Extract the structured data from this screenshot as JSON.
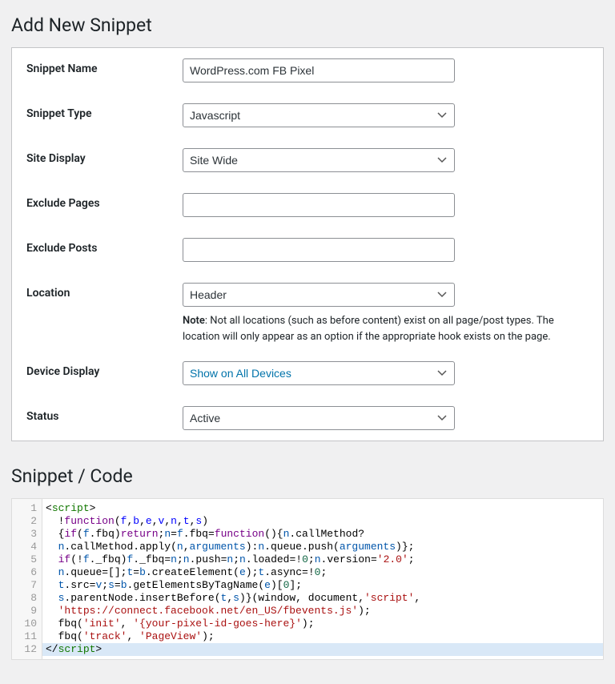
{
  "page": {
    "title": "Add New Snippet",
    "code_section_title": "Snippet / Code"
  },
  "labels": {
    "name": "Snippet Name",
    "type": "Snippet Type",
    "site_display": "Site Display",
    "exclude_pages": "Exclude Pages",
    "exclude_posts": "Exclude Posts",
    "location": "Location",
    "device_display": "Device Display",
    "status": "Status"
  },
  "values": {
    "name": "WordPress.com FB Pixel",
    "type": "Javascript",
    "site_display": "Site Wide",
    "exclude_pages": "",
    "exclude_posts": "",
    "location": "Header",
    "device_display": "Show on All Devices",
    "status": "Active"
  },
  "note": {
    "label": "Note",
    "text": ": Not all locations (such as before content) exist on all page/post types. The location will only appear as an option if the appropriate hook exists on the page."
  },
  "code": [
    {
      "n": 1,
      "html": "<span class='cm-punc'>&lt;</span><span class='cm-tag'>script</span><span class='cm-punc'>&gt;</span>"
    },
    {
      "n": 2,
      "html": "  <span class='cm-punc'>!</span><span class='cm-keyword'>function</span><span class='cm-punc'>(</span><span class='cm-def'>f</span><span class='cm-punc'>,</span><span class='cm-def'>b</span><span class='cm-punc'>,</span><span class='cm-def'>e</span><span class='cm-punc'>,</span><span class='cm-def'>v</span><span class='cm-punc'>,</span><span class='cm-def'>n</span><span class='cm-punc'>,</span><span class='cm-def'>t</span><span class='cm-punc'>,</span><span class='cm-def'>s</span><span class='cm-punc'>)</span>"
    },
    {
      "n": 3,
      "html": "  <span class='cm-punc'>{</span><span class='cm-keyword'>if</span><span class='cm-punc'>(</span><span class='cm-var2'>f</span><span class='cm-punc'>.</span><span class='cm-prop'>fbq</span><span class='cm-punc'>)</span><span class='cm-keyword'>return</span><span class='cm-punc'>;</span><span class='cm-var2'>n</span><span class='cm-punc'>=</span><span class='cm-var2'>f</span><span class='cm-punc'>.</span><span class='cm-prop'>fbq</span><span class='cm-punc'>=</span><span class='cm-keyword'>function</span><span class='cm-punc'>(){</span><span class='cm-var2'>n</span><span class='cm-punc'>.</span><span class='cm-prop'>callMethod</span><span class='cm-punc'>?</span>"
    },
    {
      "n": 4,
      "html": "  <span class='cm-var2'>n</span><span class='cm-punc'>.</span><span class='cm-prop'>callMethod</span><span class='cm-punc'>.</span><span class='cm-prop'>apply</span><span class='cm-punc'>(</span><span class='cm-var2'>n</span><span class='cm-punc'>,</span><span class='cm-var2'>arguments</span><span class='cm-punc'>):</span><span class='cm-var2'>n</span><span class='cm-punc'>.</span><span class='cm-prop'>queue</span><span class='cm-punc'>.</span><span class='cm-prop'>push</span><span class='cm-punc'>(</span><span class='cm-var2'>arguments</span><span class='cm-punc'>)};</span>"
    },
    {
      "n": 5,
      "html": "  <span class='cm-keyword'>if</span><span class='cm-punc'>(!</span><span class='cm-var2'>f</span><span class='cm-punc'>.</span><span class='cm-prop'>_fbq</span><span class='cm-punc'>)</span><span class='cm-var2'>f</span><span class='cm-punc'>.</span><span class='cm-prop'>_fbq</span><span class='cm-punc'>=</span><span class='cm-var2'>n</span><span class='cm-punc'>;</span><span class='cm-var2'>n</span><span class='cm-punc'>.</span><span class='cm-prop'>push</span><span class='cm-punc'>=</span><span class='cm-var2'>n</span><span class='cm-punc'>;</span><span class='cm-var2'>n</span><span class='cm-punc'>.</span><span class='cm-prop'>loaded</span><span class='cm-punc'>=!</span><span class='cm-num'>0</span><span class='cm-punc'>;</span><span class='cm-var2'>n</span><span class='cm-punc'>.</span><span class='cm-prop'>version</span><span class='cm-punc'>=</span><span class='cm-str'>'2.0'</span><span class='cm-punc'>;</span>"
    },
    {
      "n": 6,
      "html": "  <span class='cm-var2'>n</span><span class='cm-punc'>.</span><span class='cm-prop'>queue</span><span class='cm-punc'>=[];</span><span class='cm-var2'>t</span><span class='cm-punc'>=</span><span class='cm-var2'>b</span><span class='cm-punc'>.</span><span class='cm-prop'>createElement</span><span class='cm-punc'>(</span><span class='cm-var2'>e</span><span class='cm-punc'>);</span><span class='cm-var2'>t</span><span class='cm-punc'>.</span><span class='cm-prop'>async</span><span class='cm-punc'>=!</span><span class='cm-num'>0</span><span class='cm-punc'>;</span>"
    },
    {
      "n": 7,
      "html": "  <span class='cm-var2'>t</span><span class='cm-punc'>.</span><span class='cm-prop'>src</span><span class='cm-punc'>=</span><span class='cm-var2'>v</span><span class='cm-punc'>;</span><span class='cm-var2'>s</span><span class='cm-punc'>=</span><span class='cm-var2'>b</span><span class='cm-punc'>.</span><span class='cm-prop'>getElementsByTagName</span><span class='cm-punc'>(</span><span class='cm-var2'>e</span><span class='cm-punc'>)[</span><span class='cm-num'>0</span><span class='cm-punc'>];</span>"
    },
    {
      "n": 8,
      "html": "  <span class='cm-var2'>s</span><span class='cm-punc'>.</span><span class='cm-prop'>parentNode</span><span class='cm-punc'>.</span><span class='cm-prop'>insertBefore</span><span class='cm-punc'>(</span><span class='cm-var2'>t</span><span class='cm-punc'>,</span><span class='cm-var2'>s</span><span class='cm-punc'>)}(</span><span class='cm-var'>window</span><span class='cm-punc'>, </span><span class='cm-var'>document</span><span class='cm-punc'>,</span><span class='cm-str'>'script'</span><span class='cm-punc'>,</span>"
    },
    {
      "n": 9,
      "html": "  <span class='cm-str'>'https://connect.facebook.net/en_US/fbevents.js'</span><span class='cm-punc'>);</span>"
    },
    {
      "n": 10,
      "html": "  <span class='cm-var'>fbq</span><span class='cm-punc'>(</span><span class='cm-str'>'init'</span><span class='cm-punc'>, </span><span class='cm-str'>'{your-pixel-id-goes-here}'</span><span class='cm-punc'>);</span>"
    },
    {
      "n": 11,
      "html": "  <span class='cm-var'>fbq</span><span class='cm-punc'>(</span><span class='cm-str'>'track'</span><span class='cm-punc'>, </span><span class='cm-str'>'PageView'</span><span class='cm-punc'>);</span>"
    },
    {
      "n": 12,
      "html": "<span class='cm-punc'>&lt;/</span><span class='cm-tag'>script</span><span class='cm-punc'>&gt;</span>",
      "selected": true
    }
  ]
}
